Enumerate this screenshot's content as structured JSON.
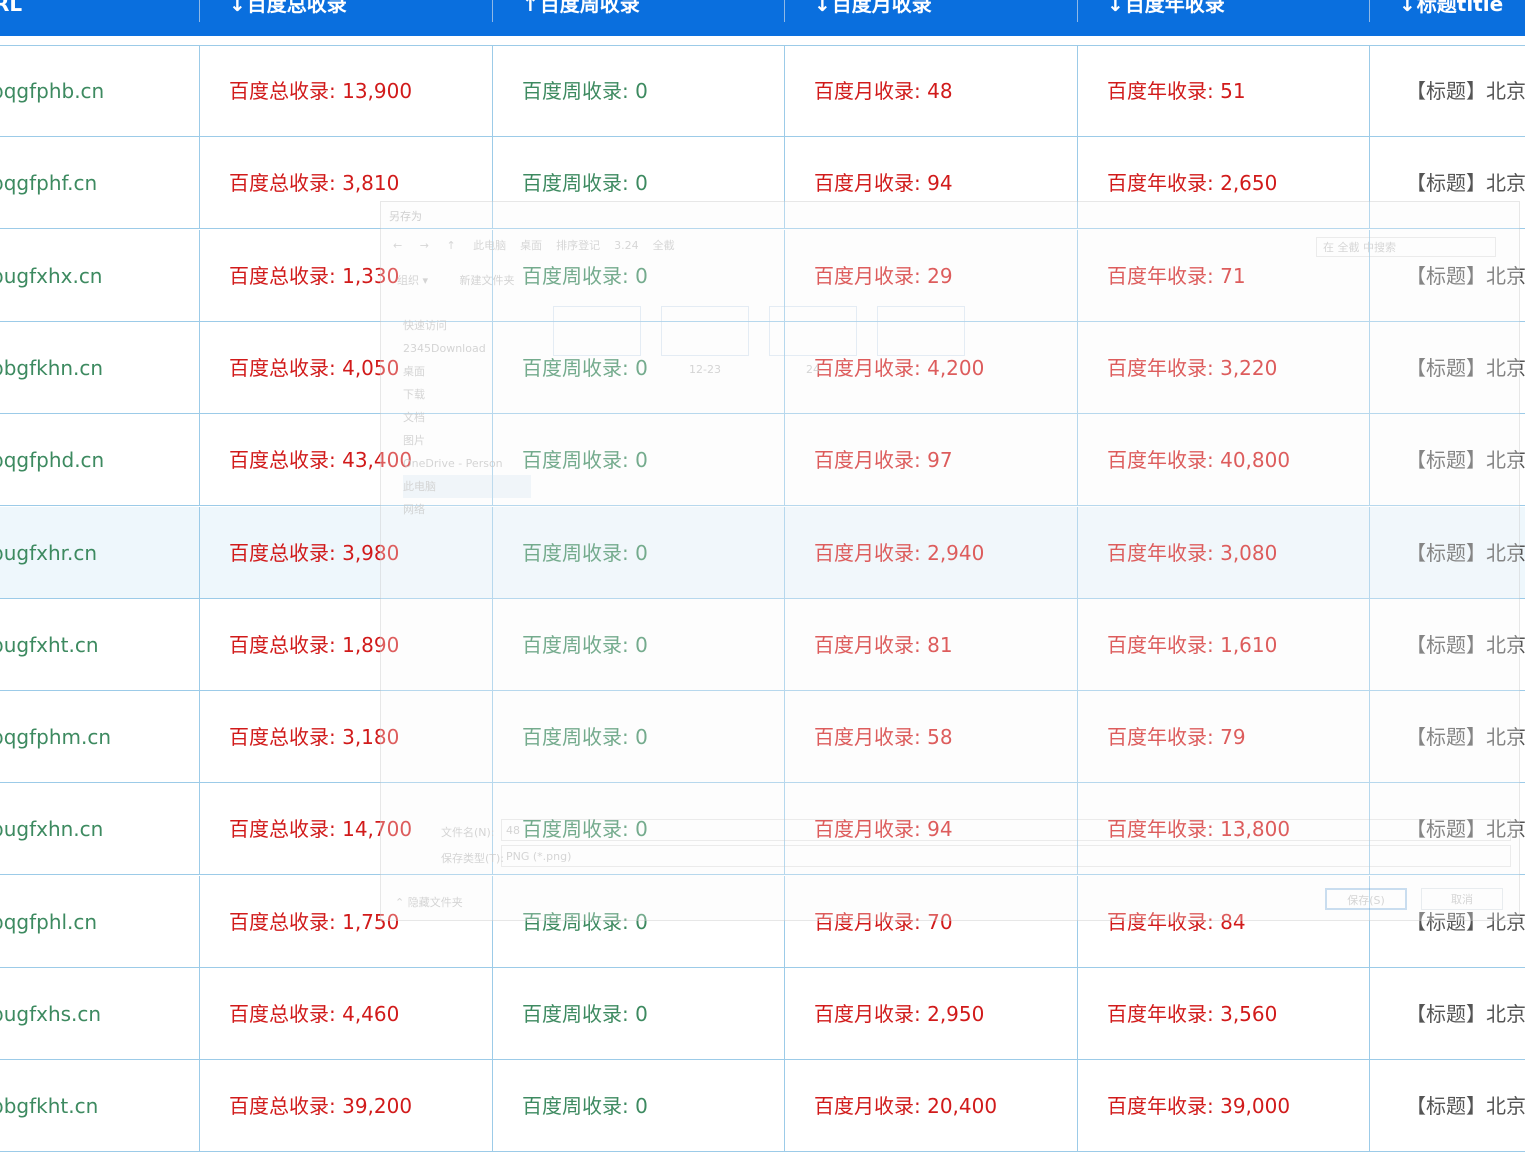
{
  "header": {
    "columns": [
      {
        "arrow": "↓",
        "label": "URL"
      },
      {
        "arrow": "↓",
        "label": "百度总收录"
      },
      {
        "arrow": "↑",
        "label": "百度周收录"
      },
      {
        "arrow": "↓",
        "label": "百度月收录"
      },
      {
        "arrow": "↓",
        "label": "百度年收录"
      },
      {
        "arrow": "↓",
        "label": "标题title"
      }
    ]
  },
  "rows": [
    {
      "url": "pqgfphb.cn",
      "total": "百度总收录: 13,900",
      "week": "百度周收录: 0",
      "month": "百度月收录: 48",
      "year": "百度年收录: 51",
      "title": "【标题】北京电"
    },
    {
      "url": "pqgfphf.cn",
      "total": "百度总收录: 3,810",
      "week": "百度周收录: 0",
      "month": "百度月收录: 94",
      "year": "百度年收录: 2,650",
      "title": "【标题】北京赛"
    },
    {
      "url": "pugfxhx.cn",
      "total": "百度总收录: 1,330",
      "week": "百度周收录: 0",
      "month": "百度月收录: 29",
      "year": "百度年收录: 71",
      "title": "【标题】北京"
    },
    {
      "url": "bbgfkhn.cn",
      "total": "百度总收录: 4,050",
      "week": "百度周收录: 0",
      "month": "百度月收录: 4,200",
      "year": "百度年收录: 3,220",
      "title": "【标题】北京"
    },
    {
      "url": "pqgfphd.cn",
      "total": "百度总收录: 43,400",
      "week": "百度周收录: 0",
      "month": "百度月收录: 97",
      "year": "百度年收录: 40,800",
      "title": "【标题】北京"
    },
    {
      "url": "pugfxhr.cn",
      "total": "百度总收录: 3,980",
      "week": "百度周收录: 0",
      "month": "百度月收录: 2,940",
      "year": "百度年收录: 3,080",
      "title": "【标题】北京"
    },
    {
      "url": "pugfxht.cn",
      "total": "百度总收录: 1,890",
      "week": "百度周收录: 0",
      "month": "百度月收录: 81",
      "year": "百度年收录: 1,610",
      "title": "【标题】北京"
    },
    {
      "url": "pqgfphm.cn",
      "total": "百度总收录: 3,180",
      "week": "百度周收录: 0",
      "month": "百度月收录: 58",
      "year": "百度年收录: 79",
      "title": "【标题】北京"
    },
    {
      "url": "pugfxhn.cn",
      "total": "百度总收录: 14,700",
      "week": "百度周收录: 0",
      "month": "百度月收录: 94",
      "year": "百度年收录: 13,800",
      "title": "【标题】北京"
    },
    {
      "url": "pqgfphl.cn",
      "total": "百度总收录: 1,750",
      "week": "百度周收录: 0",
      "month": "百度月收录: 70",
      "year": "百度年收录: 84",
      "title": "【标题】北京"
    },
    {
      "url": "pugfxhs.cn",
      "total": "百度总收录: 4,460",
      "week": "百度周收录: 0",
      "month": "百度月收录: 2,950",
      "year": "百度年收录: 3,560",
      "title": "【标题】北京"
    },
    {
      "url": "bbgfkht.cn",
      "total": "百度总收录: 39,200",
      "week": "百度周收录: 0",
      "month": "百度月收录: 20,400",
      "year": "百度年收录: 39,000",
      "title": "【标题】北京"
    }
  ],
  "highlighted_row": 5,
  "dialog": {
    "title": "另存为",
    "breadcrumb": [
      "此电脑",
      "桌面",
      "排序登记",
      "3.24",
      "全截"
    ],
    "search_placeholder": "在 全截 中搜索",
    "toolbar": [
      "组织 ▾",
      "新建文件夹"
    ],
    "nav": [
      "快速访问",
      "2345Download",
      "桌面",
      "下载",
      "文档",
      "图片",
      "OneDrive - Person",
      "此电脑",
      "网络"
    ],
    "selected_nav": 7,
    "thumbs": [
      "",
      "12-23",
      "24",
      ""
    ],
    "filename_label": "文件名(N):",
    "filename_value": "48",
    "filetype_label": "保存类型(T):",
    "filetype_value": "PNG (*.png)",
    "hide_folders": "隐藏文件夹",
    "save_label": "保存(S)",
    "cancel_label": "取消"
  },
  "colors": {
    "header_bg": "#0a6fde",
    "url_text": "#3d8a60",
    "red_text": "#d11a1a",
    "grid_line": "#9ccbe8",
    "highlight_row": "#eef7fc"
  }
}
